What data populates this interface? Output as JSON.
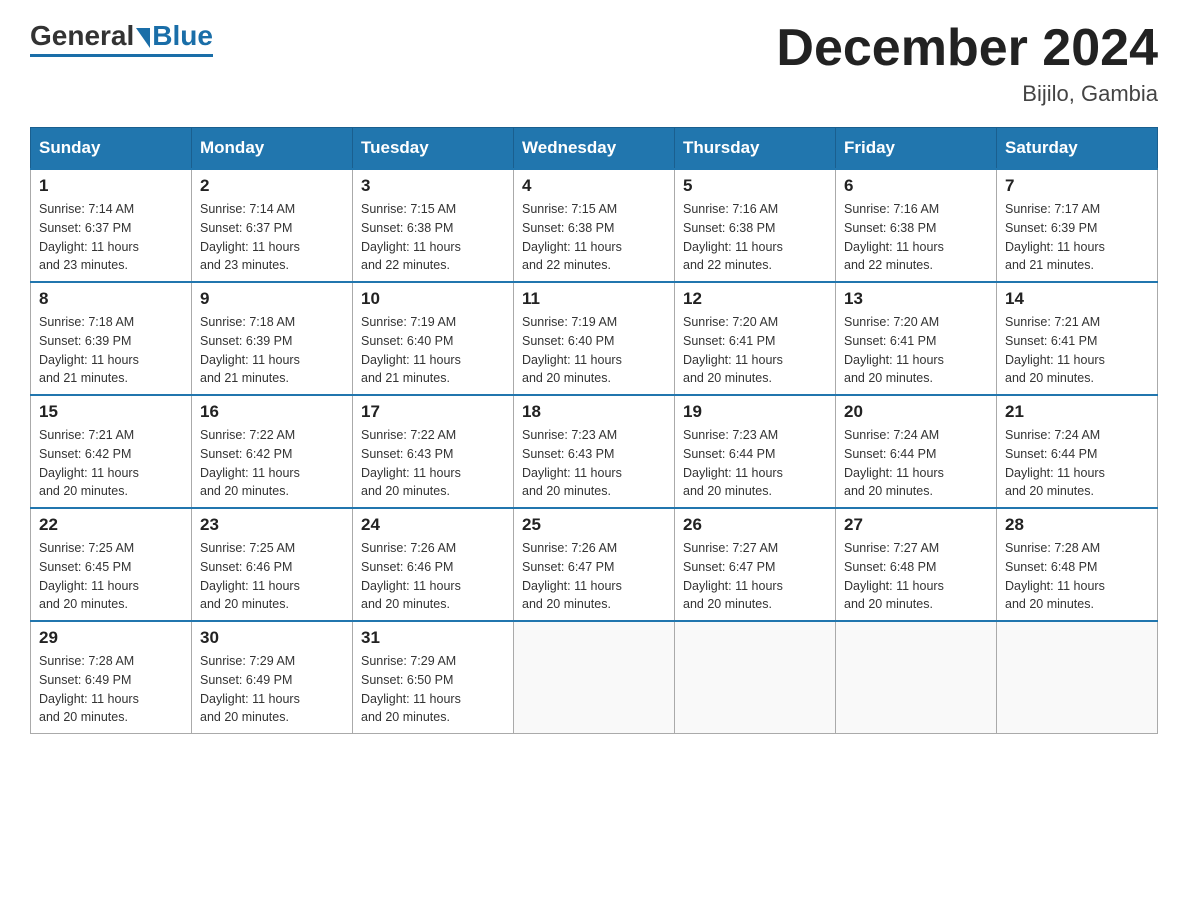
{
  "header": {
    "logo": {
      "general": "General",
      "blue": "Blue"
    },
    "title": "December 2024",
    "location": "Bijilo, Gambia"
  },
  "days_of_week": [
    "Sunday",
    "Monday",
    "Tuesday",
    "Wednesday",
    "Thursday",
    "Friday",
    "Saturday"
  ],
  "weeks": [
    [
      {
        "num": "1",
        "sunrise": "7:14 AM",
        "sunset": "6:37 PM",
        "daylight": "11 hours and 23 minutes."
      },
      {
        "num": "2",
        "sunrise": "7:14 AM",
        "sunset": "6:37 PM",
        "daylight": "11 hours and 23 minutes."
      },
      {
        "num": "3",
        "sunrise": "7:15 AM",
        "sunset": "6:38 PM",
        "daylight": "11 hours and 22 minutes."
      },
      {
        "num": "4",
        "sunrise": "7:15 AM",
        "sunset": "6:38 PM",
        "daylight": "11 hours and 22 minutes."
      },
      {
        "num": "5",
        "sunrise": "7:16 AM",
        "sunset": "6:38 PM",
        "daylight": "11 hours and 22 minutes."
      },
      {
        "num": "6",
        "sunrise": "7:16 AM",
        "sunset": "6:38 PM",
        "daylight": "11 hours and 22 minutes."
      },
      {
        "num": "7",
        "sunrise": "7:17 AM",
        "sunset": "6:39 PM",
        "daylight": "11 hours and 21 minutes."
      }
    ],
    [
      {
        "num": "8",
        "sunrise": "7:18 AM",
        "sunset": "6:39 PM",
        "daylight": "11 hours and 21 minutes."
      },
      {
        "num": "9",
        "sunrise": "7:18 AM",
        "sunset": "6:39 PM",
        "daylight": "11 hours and 21 minutes."
      },
      {
        "num": "10",
        "sunrise": "7:19 AM",
        "sunset": "6:40 PM",
        "daylight": "11 hours and 21 minutes."
      },
      {
        "num": "11",
        "sunrise": "7:19 AM",
        "sunset": "6:40 PM",
        "daylight": "11 hours and 20 minutes."
      },
      {
        "num": "12",
        "sunrise": "7:20 AM",
        "sunset": "6:41 PM",
        "daylight": "11 hours and 20 minutes."
      },
      {
        "num": "13",
        "sunrise": "7:20 AM",
        "sunset": "6:41 PM",
        "daylight": "11 hours and 20 minutes."
      },
      {
        "num": "14",
        "sunrise": "7:21 AM",
        "sunset": "6:41 PM",
        "daylight": "11 hours and 20 minutes."
      }
    ],
    [
      {
        "num": "15",
        "sunrise": "7:21 AM",
        "sunset": "6:42 PM",
        "daylight": "11 hours and 20 minutes."
      },
      {
        "num": "16",
        "sunrise": "7:22 AM",
        "sunset": "6:42 PM",
        "daylight": "11 hours and 20 minutes."
      },
      {
        "num": "17",
        "sunrise": "7:22 AM",
        "sunset": "6:43 PM",
        "daylight": "11 hours and 20 minutes."
      },
      {
        "num": "18",
        "sunrise": "7:23 AM",
        "sunset": "6:43 PM",
        "daylight": "11 hours and 20 minutes."
      },
      {
        "num": "19",
        "sunrise": "7:23 AM",
        "sunset": "6:44 PM",
        "daylight": "11 hours and 20 minutes."
      },
      {
        "num": "20",
        "sunrise": "7:24 AM",
        "sunset": "6:44 PM",
        "daylight": "11 hours and 20 minutes."
      },
      {
        "num": "21",
        "sunrise": "7:24 AM",
        "sunset": "6:44 PM",
        "daylight": "11 hours and 20 minutes."
      }
    ],
    [
      {
        "num": "22",
        "sunrise": "7:25 AM",
        "sunset": "6:45 PM",
        "daylight": "11 hours and 20 minutes."
      },
      {
        "num": "23",
        "sunrise": "7:25 AM",
        "sunset": "6:46 PM",
        "daylight": "11 hours and 20 minutes."
      },
      {
        "num": "24",
        "sunrise": "7:26 AM",
        "sunset": "6:46 PM",
        "daylight": "11 hours and 20 minutes."
      },
      {
        "num": "25",
        "sunrise": "7:26 AM",
        "sunset": "6:47 PM",
        "daylight": "11 hours and 20 minutes."
      },
      {
        "num": "26",
        "sunrise": "7:27 AM",
        "sunset": "6:47 PM",
        "daylight": "11 hours and 20 minutes."
      },
      {
        "num": "27",
        "sunrise": "7:27 AM",
        "sunset": "6:48 PM",
        "daylight": "11 hours and 20 minutes."
      },
      {
        "num": "28",
        "sunrise": "7:28 AM",
        "sunset": "6:48 PM",
        "daylight": "11 hours and 20 minutes."
      }
    ],
    [
      {
        "num": "29",
        "sunrise": "7:28 AM",
        "sunset": "6:49 PM",
        "daylight": "11 hours and 20 minutes."
      },
      {
        "num": "30",
        "sunrise": "7:29 AM",
        "sunset": "6:49 PM",
        "daylight": "11 hours and 20 minutes."
      },
      {
        "num": "31",
        "sunrise": "7:29 AM",
        "sunset": "6:50 PM",
        "daylight": "11 hours and 20 minutes."
      },
      null,
      null,
      null,
      null
    ]
  ],
  "labels": {
    "sunrise": "Sunrise:",
    "sunset": "Sunset:",
    "daylight": "Daylight:"
  }
}
